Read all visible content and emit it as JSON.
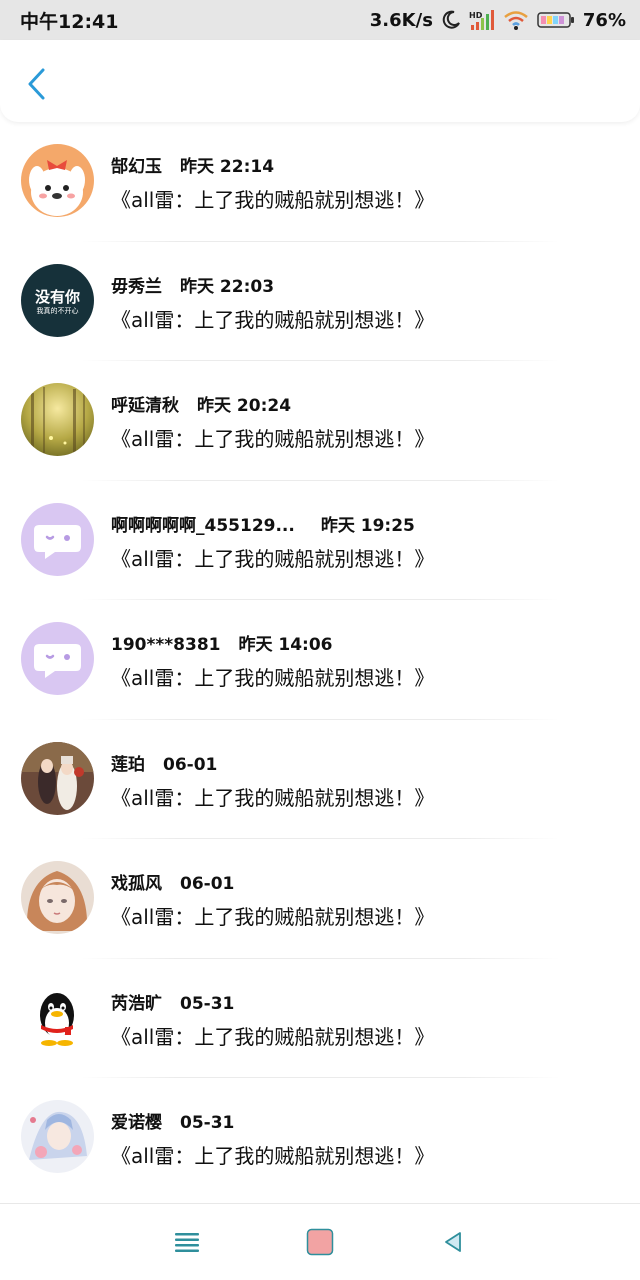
{
  "status_bar": {
    "time": "中午12:41",
    "net_speed": "3.6K/s",
    "battery": "76%",
    "icons": [
      "moon-icon",
      "signal-icon",
      "wifi-icon",
      "battery-icon"
    ]
  },
  "header": {
    "back_icon": "chevron-left-icon",
    "accent_color": "#2a9ad8"
  },
  "comments": [
    {
      "name": "郜幻玉",
      "time": "昨天 22:14",
      "message": "《all雷：上了我的贼船就别想逃！》",
      "avatar": "cartoon-puppy-avatar"
    },
    {
      "name": "毋秀兰",
      "time": "昨天 22:03",
      "message": "《all雷：上了我的贼船就别想逃！》",
      "avatar": "text-avatar",
      "avatar_text_main": "没有你",
      "avatar_text_sub": "我真的不开心"
    },
    {
      "name": "呼延清秋",
      "time": "昨天 20:24",
      "message": "《all雷：上了我的贼船就别想逃！》",
      "avatar": "forest-avatar"
    },
    {
      "name": "啊啊啊啊啊_455129...",
      "time": "昨天 19:25",
      "message": "《all雷：上了我的贼船就别想逃！》",
      "avatar": "default-chat-avatar"
    },
    {
      "name": "190***8381",
      "time": "昨天 14:06",
      "message": "《all雷：上了我的贼船就别想逃！》",
      "avatar": "default-chat-avatar"
    },
    {
      "name": "莲珀",
      "time": "06-01",
      "message": "《all雷：上了我的贼船就别想逃！》",
      "avatar": "anime-couple-avatar"
    },
    {
      "name": "戏孤风",
      "time": "06-01",
      "message": "《all雷：上了我的贼船就别想逃！》",
      "avatar": "anime-girl-avatar"
    },
    {
      "name": "芮浩旷",
      "time": "05-31",
      "message": "《all雷：上了我的贼船就别想逃！》",
      "avatar": "penguin-avatar"
    },
    {
      "name": "爱诺樱",
      "time": "05-31",
      "message": "《all雷：上了我的贼船就别想逃！》",
      "avatar": "anime-art-avatar"
    }
  ],
  "nav_bar": {
    "buttons": [
      "menu-icon",
      "home-icon",
      "back-triangle-icon"
    ],
    "icon_color": "#2f8f9c"
  }
}
